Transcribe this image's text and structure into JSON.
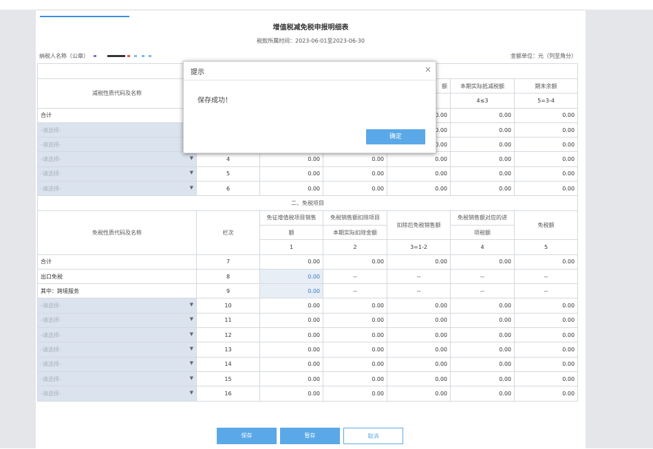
{
  "form": {
    "title": "增值税减免税申报明细表",
    "period": "税款所属时间：2023-06-01至2023-06-30",
    "taxpayer_label": "纳税人名称（公章）",
    "unit_label": "金额单位：元（列至角分）"
  },
  "reduction": {
    "header_code_name": "减税性质代码及名称",
    "col_actual": "本期实际抵减税额",
    "col_actual_partial": "额",
    "col_end": "期末余额",
    "formula_actual": "4≤3",
    "formula_end": "5=3-4",
    "total_label": "合计",
    "total_values": [
      "0.00",
      "0.00",
      "0.00"
    ],
    "rows": [
      {
        "name": "-请选择-",
        "line": "",
        "values": [
          "",
          "",
          "",
          "0.00",
          "0.00",
          "0.00"
        ]
      },
      {
        "name": "-请选择-",
        "line": "",
        "values": [
          "",
          "",
          "",
          "0.00",
          "0.00",
          "0.00"
        ]
      },
      {
        "name": "-请选择-",
        "line": "4",
        "values": [
          "0.00",
          "0.00",
          "0.00",
          "0.00",
          "0.00"
        ]
      },
      {
        "name": "-请选择-",
        "line": "5",
        "values": [
          "0.00",
          "0.00",
          "0.00",
          "0.00",
          "0.00"
        ]
      },
      {
        "name": "-请选择-",
        "line": "6",
        "values": [
          "0.00",
          "0.00",
          "0.00",
          "0.00",
          "0.00"
        ]
      }
    ]
  },
  "exemption": {
    "section_title": "二、免税项目",
    "header_code_name": "免税性质代码及名称",
    "header_line": "栏次",
    "headers": [
      "免征增值税项目销售额",
      "免税销售额扣除项目本期实际扣除金额",
      "扣除后免税销售额",
      "免税销售额对应的进项税额",
      "免税额"
    ],
    "header_col1_line1": "免征增值税项目销售",
    "header_col1_line2": "额",
    "header_col2_line1": "免税销售额扣除项目",
    "header_col2_line2": "本期实际扣除金额",
    "header_col4_line1": "免税销售额对应的进",
    "header_col4_line2": "项税额",
    "formulas": [
      "1",
      "2",
      "3=1-2",
      "4",
      "5"
    ],
    "fixed_rows": [
      {
        "name": "合计",
        "line": "7",
        "values": [
          "0.00",
          "0.00",
          "0.00",
          "0.00",
          "0.00"
        ]
      },
      {
        "name": "出口免税",
        "line": "8",
        "values": [
          "0.00",
          "--",
          "--",
          "--",
          "--"
        ]
      },
      {
        "name": "其中：跨境服务",
        "line": "9",
        "values": [
          "0.00",
          "--",
          "--",
          "--",
          "--"
        ]
      }
    ],
    "rows": [
      {
        "name": "-请选择-",
        "line": "10"
      },
      {
        "name": "-请选择-",
        "line": "11"
      },
      {
        "name": "-请选择-",
        "line": "12"
      },
      {
        "name": "-请选择-",
        "line": "13"
      },
      {
        "name": "-请选择-",
        "line": "14"
      },
      {
        "name": "-请选择-",
        "line": "15"
      },
      {
        "name": "-请选择-",
        "line": "16"
      }
    ],
    "zero": "0.00"
  },
  "buttons": {
    "save": "保存",
    "draft": "暂存",
    "cancel": "取消"
  },
  "dialog": {
    "title": "提示",
    "message": "保存成功！",
    "ok": "确定",
    "close": "×"
  },
  "colors": {
    "primary": "#5aa8e8",
    "select_bg": "#dbe3ee",
    "editable_bg": "#e8eef6",
    "mask_dark": "#333333",
    "mask_red": "#e05a4a",
    "mask_blue": "#7fb6ee",
    "mask_purple": "#8a6cc8"
  }
}
